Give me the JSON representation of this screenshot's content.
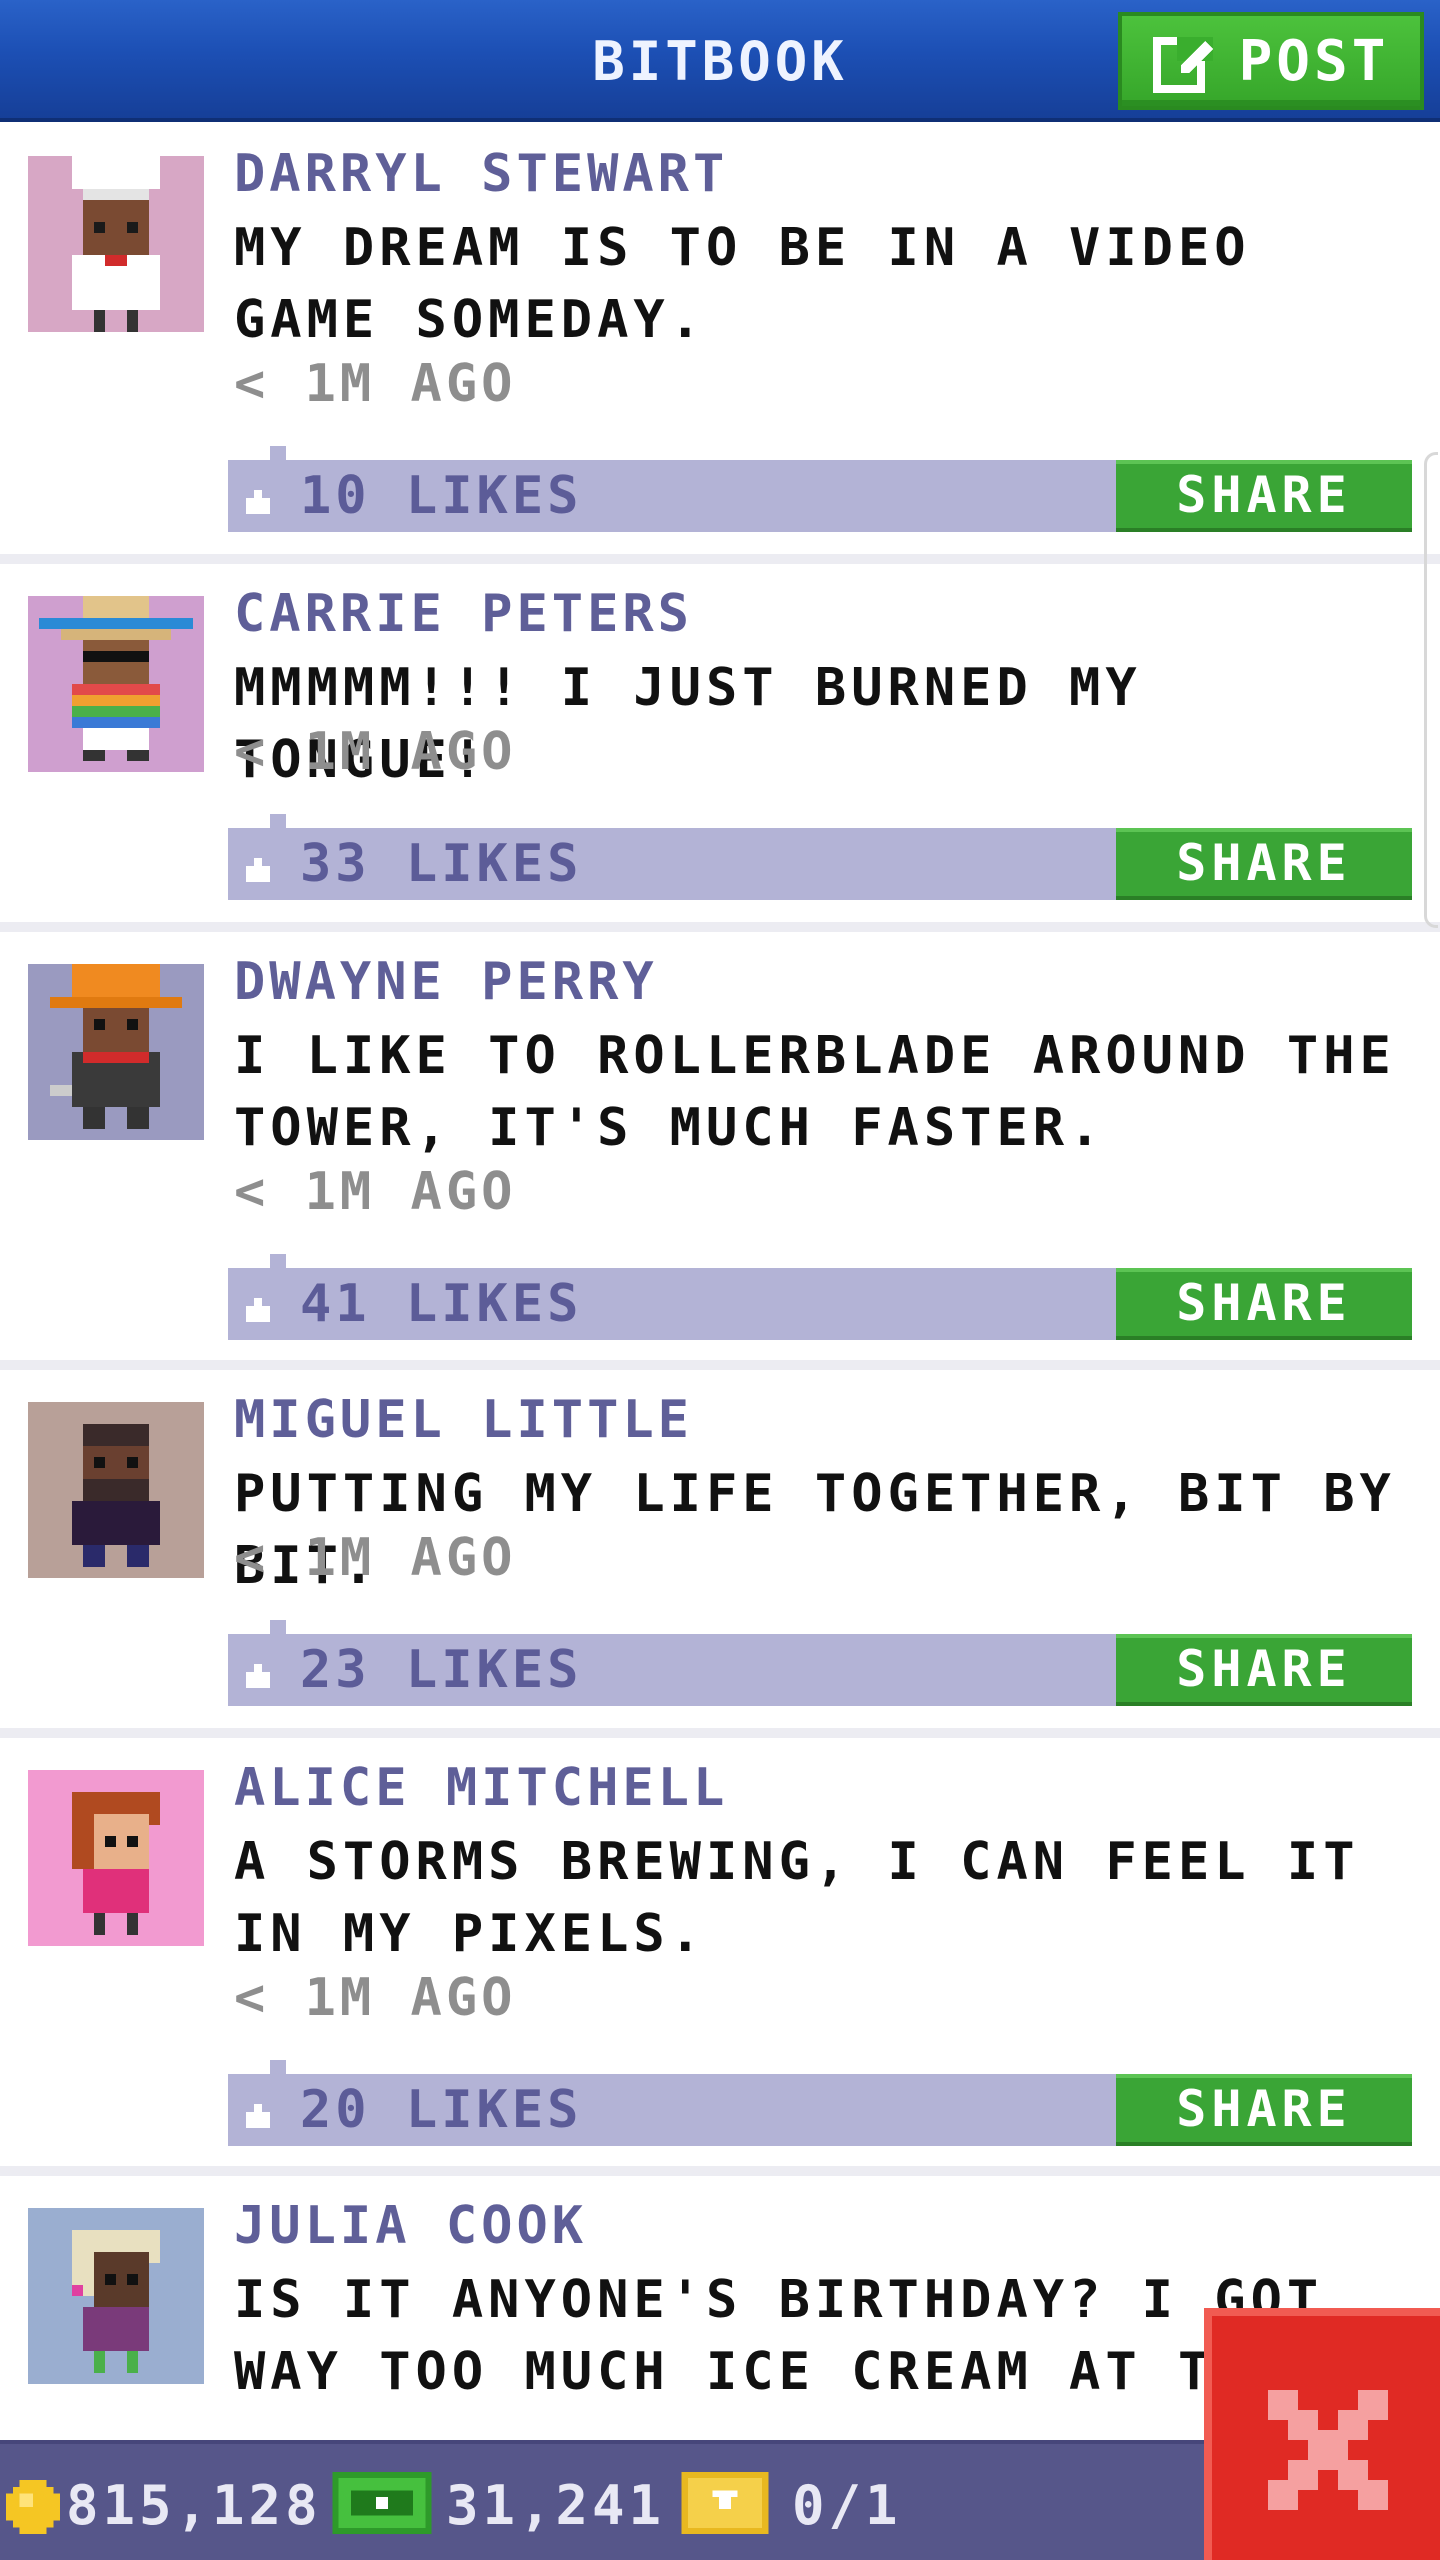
{
  "header": {
    "title": "BITBOOK",
    "post_label": "POST"
  },
  "posts": [
    {
      "name": "DARRYL STEWART",
      "message": "MY DREAM IS TO BE IN A VIDEO GAME SOMEDAY.",
      "time": "< 1M AGO",
      "likes": "10 LIKES",
      "share_label": "SHARE",
      "avatar": "chef-avatar"
    },
    {
      "name": "CARRIE PETERS",
      "message": "MMMMM!!! I JUST BURNED MY TONGUE!",
      "time": "< 1M AGO",
      "likes": "33 LIKES",
      "share_label": "SHARE",
      "avatar": "sombrero-avatar"
    },
    {
      "name": "DWAYNE PERRY",
      "message": "I LIKE TO ROLLERBLADE AROUND THE TOWER, IT'S MUCH FASTER.",
      "time": "< 1M AGO",
      "likes": "41 LIKES",
      "share_label": "SHARE",
      "avatar": "hardhat-avatar"
    },
    {
      "name": "MIGUEL LITTLE",
      "message": "PUTTING MY LIFE TOGETHER, BIT BY BIT.",
      "time": "< 1M AGO",
      "likes": "23 LIKES",
      "share_label": "SHARE",
      "avatar": "bearded-avatar"
    },
    {
      "name": "ALICE MITCHELL",
      "message": "A STORMS BREWING, I CAN FEEL IT IN MY PIXELS.",
      "time": "< 1M AGO",
      "likes": "20 LIKES",
      "share_label": "SHARE",
      "avatar": "redhead-avatar"
    },
    {
      "name": "JULIA COOK",
      "message": "IS IT ANYONE'S BIRTHDAY? I GOT WAY TOO MUCH ICE CREAM AT THE BU",
      "avatar": "blonde-avatar"
    }
  ],
  "footer": {
    "coins": "815,128",
    "bux": "31,241",
    "tickets": "0/1"
  },
  "colors": {
    "header": "#1c4fb4",
    "post_button": "#3db52f",
    "name_text": "#5f5f98",
    "like_bar": "#b3b3d6",
    "share_button": "#3aa536",
    "footer": "#56568a",
    "close_button": "#e02a24"
  }
}
